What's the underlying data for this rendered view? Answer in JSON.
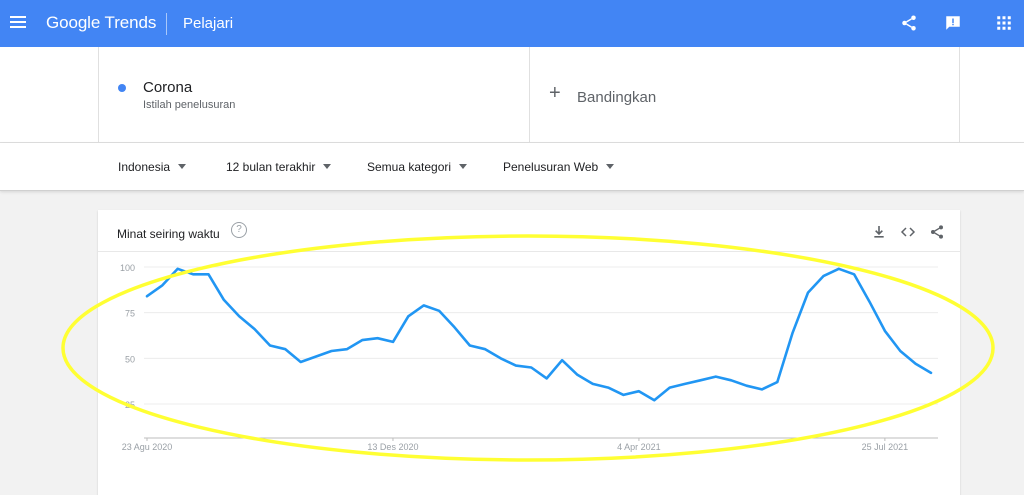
{
  "header": {
    "logo_text": "Google Trends",
    "nav_label": "Pelajari",
    "bar_color": "#4285f4"
  },
  "term": {
    "name": "Corona",
    "subtitle": "Istilah penelusuran",
    "color": "#4285f4"
  },
  "compare": {
    "label": "Bandingkan"
  },
  "filters": {
    "region": "Indonesia",
    "period": "12 bulan terakhir",
    "category": "Semua kategori",
    "search_type": "Penelusuran Web"
  },
  "card": {
    "title": "Minat seiring waktu",
    "help": "?"
  },
  "chart_data": {
    "type": "line",
    "title": "Minat seiring waktu",
    "xlabel": "",
    "ylabel": "",
    "ylim": [
      0,
      100
    ],
    "y_ticks": [
      25,
      50,
      75,
      100
    ],
    "x_tick_labels": [
      "23 Agu 2020",
      "13 Des 2020",
      "4 Apr 2021",
      "25 Jul 2021"
    ],
    "x_tick_indices": [
      0,
      16,
      32,
      48
    ],
    "grid": true,
    "line_color": "#2196f3",
    "series": [
      {
        "name": "Corona",
        "values": [
          84,
          90,
          99,
          96,
          96,
          82,
          73,
          66,
          57,
          55,
          48,
          51,
          54,
          55,
          60,
          61,
          59,
          73,
          79,
          76,
          67,
          57,
          55,
          50,
          46,
          45,
          39,
          49,
          41,
          36,
          34,
          30,
          32,
          27,
          34,
          36,
          38,
          40,
          38,
          35,
          33,
          37,
          64,
          86,
          95,
          99,
          96,
          81,
          65,
          54,
          47,
          42
        ]
      }
    ]
  },
  "annotation": {
    "shape": "ellipse",
    "color": "#ffff33"
  }
}
